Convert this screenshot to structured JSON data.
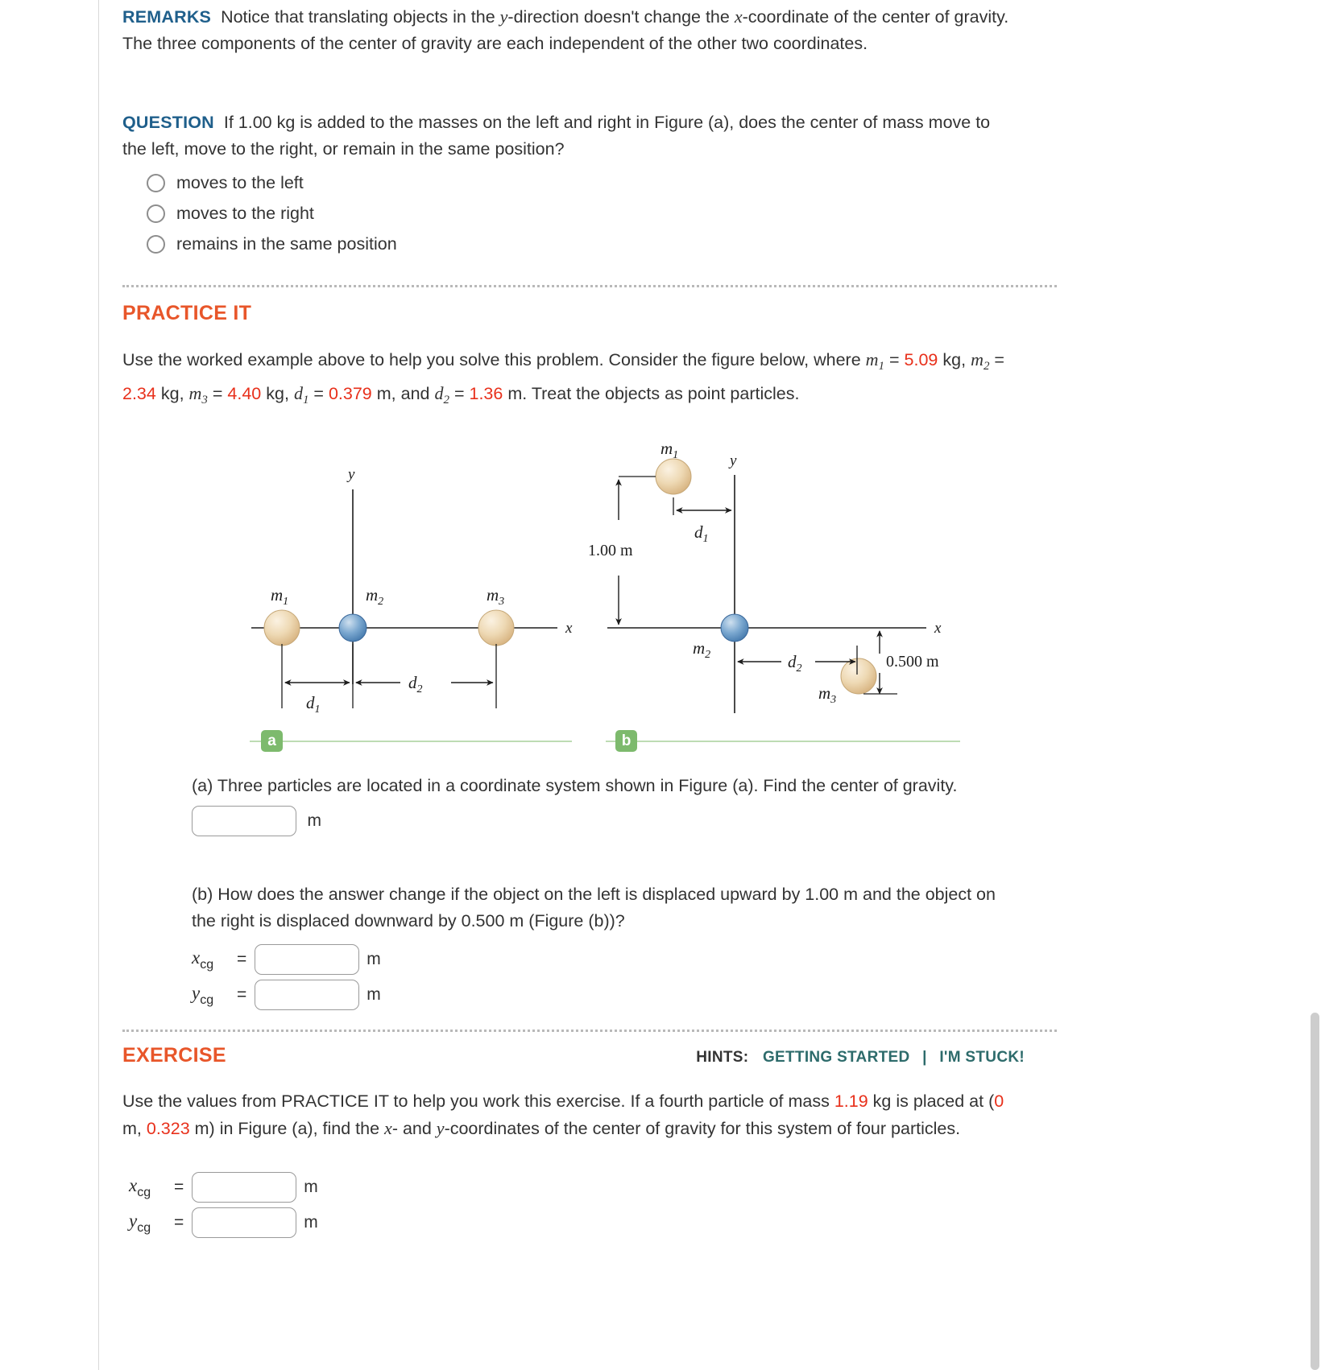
{
  "remarks": {
    "heading": "REMARKS",
    "text_part1": "Notice that translating objects in the ",
    "y_var": "y",
    "text_part2": "-direction doesn't change the ",
    "x_var": "x",
    "text_part3": "-coordinate of the center of gravity. The three components of the center of gravity are each independent of the other two coordinates."
  },
  "question": {
    "heading": "QUESTION",
    "text": "If 1.00 kg is added to the masses on the left and right in Figure (a), does the center of mass move to the left, move to the right, or remain in the same position?",
    "options": [
      {
        "label": "moves to the left",
        "selected": false
      },
      {
        "label": "moves to the right",
        "selected": false
      },
      {
        "label": "remains in the same position",
        "selected": false
      }
    ]
  },
  "practice": {
    "title": "PRACTICE IT",
    "intro": "Use the worked example above to help you solve this problem. Consider the figure below, where",
    "givens": {
      "m1": "5.09",
      "m1_unit": "kg",
      "m2": "2.34",
      "m2_unit": "kg",
      "m3": "4.40",
      "m3_unit": "kg",
      "d1": "0.379",
      "d1_unit": "m",
      "d2": "1.36",
      "d2_unit": "m"
    },
    "tail": "Treat the objects as point particles."
  },
  "figure": {
    "badge_a": "a",
    "badge_b": "b",
    "panel_a": {
      "y_axis_label": "y",
      "x_axis_label": "x",
      "mass_labels": [
        "m",
        "m",
        "m"
      ],
      "mass_subscripts": [
        "1",
        "2",
        "3"
      ],
      "dim_d1": "d",
      "dim_d1_sub": "1",
      "dim_d2": "d",
      "dim_d2_sub": "2"
    },
    "panel_b": {
      "y_axis_label": "y",
      "x_axis_label": "x",
      "m1_label": "m",
      "m1_sub": "1",
      "m2_label": "m",
      "m2_sub": "2",
      "m3_label": "m",
      "m3_sub": "3",
      "dim_d1": "d",
      "dim_d1_sub": "1",
      "dim_d2": "d",
      "dim_d2_sub": "2",
      "vertical_up_label": "1.00 m",
      "vertical_down_label": "0.500 m"
    }
  },
  "part_a": {
    "text": "(a) Three particles are located in a coordinate system shown in Figure (a). Find the center of gravity.",
    "input_value": "",
    "unit": "m"
  },
  "part_b": {
    "text": "(b) How does the answer change if the object on the left is displaced upward by 1.00 m and the object on the right is displaced downward by 0.500 m (Figure (b))?",
    "rows": [
      {
        "var": "x",
        "sub": "cg",
        "eq": "=",
        "value": "",
        "unit": "m"
      },
      {
        "var": "y",
        "sub": "cg",
        "eq": "=",
        "value": "",
        "unit": "m"
      }
    ]
  },
  "exercise": {
    "title": "EXERCISE",
    "hints_label": "HINTS:",
    "hint_getting_started": "GETTING STARTED",
    "hint_divider": "|",
    "hint_im_stuck": "I'M STUCK!",
    "text_1": "Use the values from PRACTICE IT to help you work this exercise. If a fourth particle of mass ",
    "mass_value": "1.19",
    "text_2": " kg is placed at (",
    "coord_x": "0",
    "text_3": " m, ",
    "coord_y": "0.323",
    "text_4": " m) in Figure (a), find the ",
    "x_var": "x",
    "text_5": "- and ",
    "y_var": "y",
    "text_6": "-coordinates of the center of gravity for this system of four particles.",
    "rows": [
      {
        "var": "x",
        "sub": "cg",
        "eq": "=",
        "value": "",
        "unit": "m"
      },
      {
        "var": "y",
        "sub": "cg",
        "eq": "=",
        "value": "",
        "unit": "m"
      }
    ]
  },
  "colors": {
    "heading_blue": "#1f5f8b",
    "heading_orange": "#e8562a",
    "value_red": "#e8301b",
    "hint_teal": "#2d6b6b",
    "badge_green": "#7dba6d",
    "sphere_tan": "#e8cfa9",
    "sphere_blue": "#6e9ec9"
  }
}
